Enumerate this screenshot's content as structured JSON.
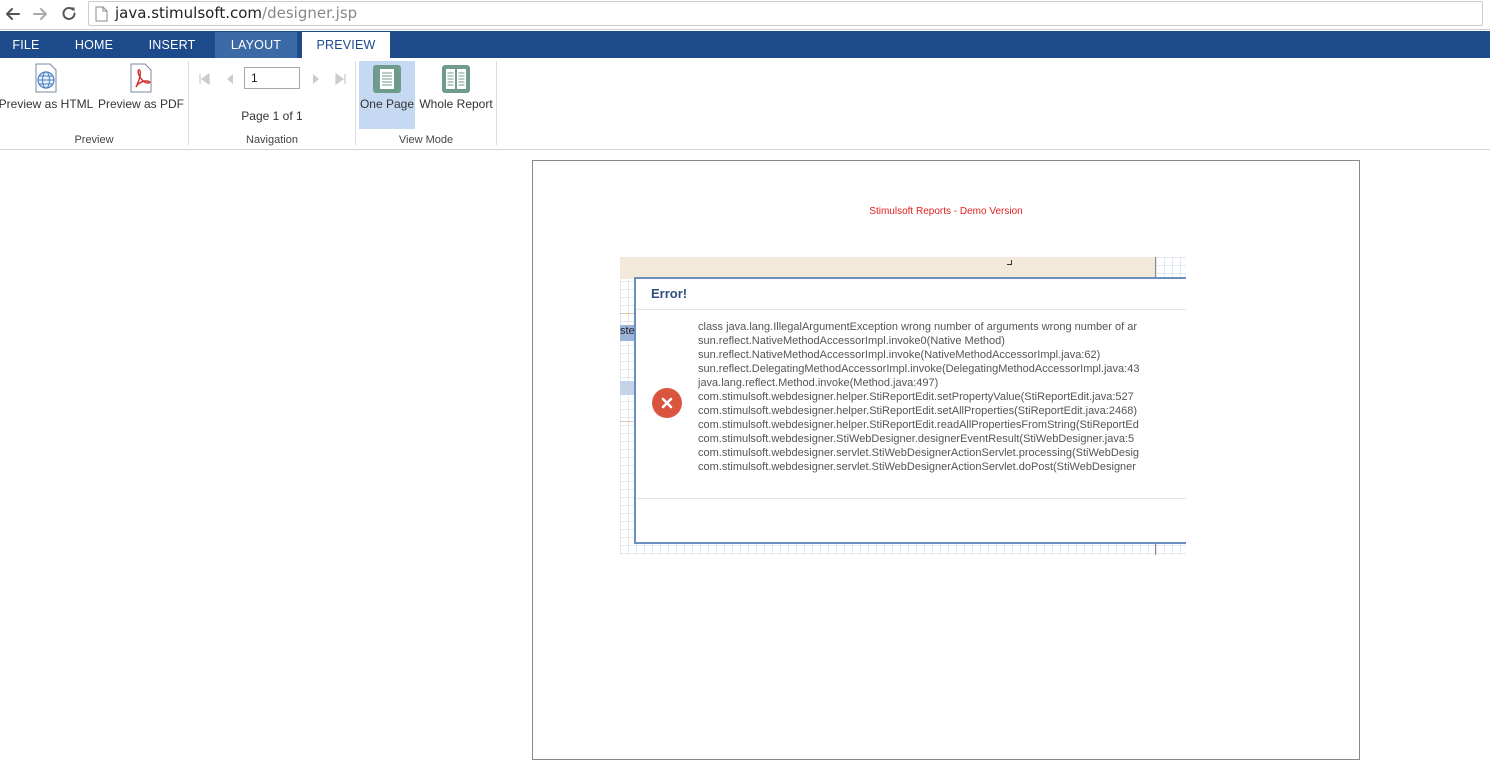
{
  "browser": {
    "url_host": "java.stimulsoft.com",
    "url_path": "/designer.jsp",
    "icons": [
      "back-arrow-icon",
      "forward-arrow-icon",
      "reload-icon",
      "page-icon"
    ]
  },
  "tabs": [
    {
      "label": "FILE",
      "state": "normal"
    },
    {
      "label": "HOME",
      "state": "normal"
    },
    {
      "label": "INSERT",
      "state": "normal"
    },
    {
      "label": "LAYOUT",
      "state": "highlighted"
    },
    {
      "label": "PREVIEW",
      "state": "active"
    }
  ],
  "ribbon": {
    "preview_group": {
      "label": "Preview",
      "html_button": "Preview as HTML",
      "pdf_button": "Preview as PDF"
    },
    "navigation_group": {
      "label": "Navigation",
      "page_value": "1",
      "page_count": "Page 1 of 1"
    },
    "viewmode_group": {
      "label": "View Mode",
      "one_page": "One Page",
      "whole_report": "Whole Report",
      "selected": "One Page"
    }
  },
  "report": {
    "demo_text": "Stimulsoft Reports - Demo Version",
    "embedded_shot": {
      "band_text": "ste",
      "error_dialog": {
        "title": "Error!",
        "lines": [
          "class java.lang.IllegalArgumentException wrong number of arguments wrong number of ar",
          "sun.reflect.NativeMethodAccessorImpl.invoke0(Native Method)",
          "sun.reflect.NativeMethodAccessorImpl.invoke(NativeMethodAccessorImpl.java:62)",
          "sun.reflect.DelegatingMethodAccessorImpl.invoke(DelegatingMethodAccessorImpl.java:43",
          "java.lang.reflect.Method.invoke(Method.java:497)",
          "com.stimulsoft.webdesigner.helper.StiReportEdit.setPropertyValue(StiReportEdit.java:527",
          "com.stimulsoft.webdesigner.helper.StiReportEdit.setAllProperties(StiReportEdit.java:2468)",
          "com.stimulsoft.webdesigner.helper.StiReportEdit.readAllPropertiesFromString(StiReportEd",
          "com.stimulsoft.webdesigner.StiWebDesigner.designerEventResult(StiWebDesigner.java:5",
          "com.stimulsoft.webdesigner.servlet.StiWebDesignerActionServlet.processing(StiWebDesig",
          "com.stimulsoft.webdesigner.servlet.StiWebDesignerActionServlet.doPost(StiWebDesigner"
        ]
      }
    }
  },
  "colors": {
    "ribbon_blue": "#1c4a8a",
    "selected_bg": "#c5d9f3",
    "demo_red": "#e02020",
    "error_red": "#d9553d"
  }
}
